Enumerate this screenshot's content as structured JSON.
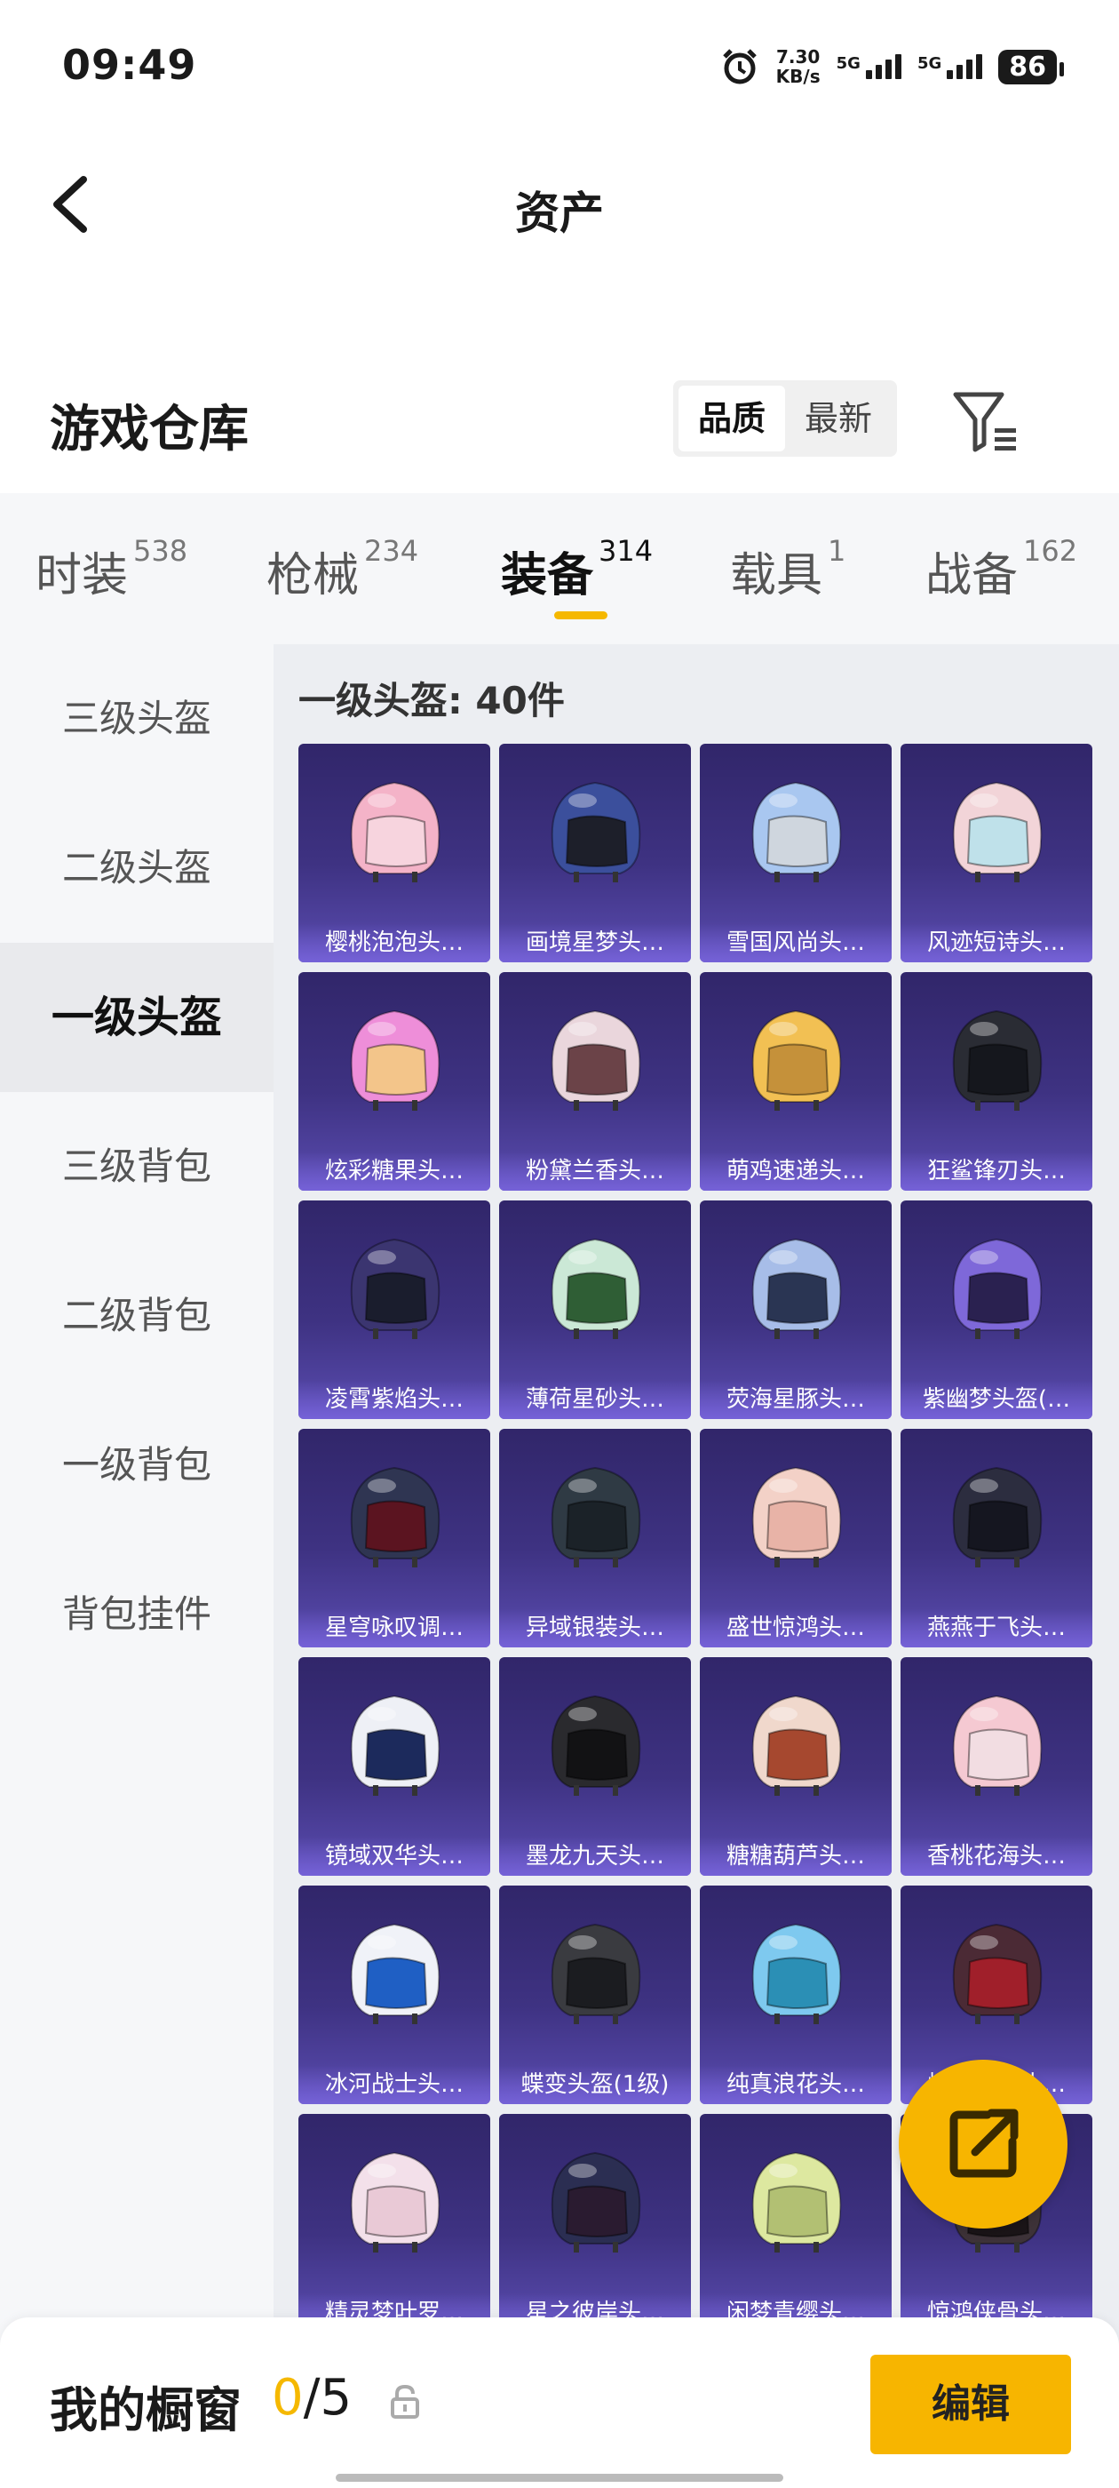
{
  "status_bar": {
    "time": "09:49",
    "net_speed_value": "7.30",
    "net_speed_unit": "KB/s",
    "sim1": "5G",
    "sim2": "5G",
    "battery": "86"
  },
  "nav": {
    "title": "资产",
    "back_icon": "chevron-left-icon"
  },
  "header": {
    "title": "游戏仓库",
    "sort_options": [
      "品质",
      "最新"
    ],
    "sort_selected": "品质",
    "filter_icon": "filter-icon"
  },
  "tabs": [
    {
      "label": "时装",
      "count": "538"
    },
    {
      "label": "枪械",
      "count": "234"
    },
    {
      "label": "装备",
      "count": "314"
    },
    {
      "label": "载具",
      "count": "1"
    },
    {
      "label": "战备",
      "count": "162"
    }
  ],
  "active_tab": "装备",
  "sidebar": {
    "items": [
      "三级头盔",
      "二级头盔",
      "一级头盔",
      "三级背包",
      "二级背包",
      "一级背包",
      "背包挂件"
    ],
    "active": "一级头盔"
  },
  "section_title": "一级头盔: 40件",
  "items": [
    {
      "label": "樱桃泡泡头…",
      "color": "#f4b3c8",
      "visor": "#f7d4de"
    },
    {
      "label": "画境星梦头…",
      "color": "#3b4f9c",
      "visor": "#1d1f2a"
    },
    {
      "label": "雪国风尚头…",
      "color": "#a9c7f0",
      "visor": "#cfd6de"
    },
    {
      "label": "风迹短诗头…",
      "color": "#f2d4d8",
      "visor": "#bfe1ea"
    },
    {
      "label": "炫彩糖果头…",
      "color": "#ee8ed9",
      "visor": "#f3c58a"
    },
    {
      "label": "粉黛兰香头…",
      "color": "#ead6dc",
      "visor": "#6b4348"
    },
    {
      "label": "萌鸡速递头…",
      "color": "#f2c053",
      "visor": "#c5913a"
    },
    {
      "label": "狂鲨锋刃头…",
      "color": "#2a2c34",
      "visor": "#15171d"
    },
    {
      "label": "凌霄紫焰头…",
      "color": "#3b3570",
      "visor": "#1a1d2d"
    },
    {
      "label": "薄荷星砂头…",
      "color": "#cbe8d6",
      "visor": "#2f5e35"
    },
    {
      "label": "荧海星豚头…",
      "color": "#a7bde8",
      "visor": "#2a3553"
    },
    {
      "label": "紫幽梦头盔(…",
      "color": "#7e68d9",
      "visor": "#2a2150"
    },
    {
      "label": "星穹咏叹调…",
      "color": "#2f3552",
      "visor": "#5b1420"
    },
    {
      "label": "异域银装头…",
      "color": "#2f3a44",
      "visor": "#1b2228"
    },
    {
      "label": "盛世惊鸿头…",
      "color": "#f3d1c7",
      "visor": "#e8b3a7"
    },
    {
      "label": "燕燕于飞头…",
      "color": "#2c2d3f",
      "visor": "#151620"
    },
    {
      "label": "镜域双华头…",
      "color": "#eef0f6",
      "visor": "#1c2a5c"
    },
    {
      "label": "墨龙九天头…",
      "color": "#2a2a2e",
      "visor": "#121214"
    },
    {
      "label": "糖糖葫芦头…",
      "color": "#f0d8cc",
      "visor": "#a6482f"
    },
    {
      "label": "香桃花海头…",
      "color": "#f5c9d2",
      "visor": "#f2dde2"
    },
    {
      "label": "冰河战士头…",
      "color": "#f0f2f8",
      "visor": "#1f5fc4"
    },
    {
      "label": "蝶变头盔(1级)",
      "color": "#3a3b40",
      "visor": "#1b1c20"
    },
    {
      "label": "纯真浪花头…",
      "color": "#7ec9ef",
      "visor": "#2b8fb5"
    },
    {
      "label": "烁金漫步头…",
      "color": "#4b2a35",
      "visor": "#a01f2a"
    },
    {
      "label": "精灵梦叶罗…",
      "color": "#f3e0ea",
      "visor": "#e9c9d6"
    },
    {
      "label": "星之彼岸头…",
      "color": "#2b2e52",
      "visor": "#2a1b30"
    },
    {
      "label": "闲梦青缨头…",
      "color": "#dde8a0",
      "visor": "#b2c073"
    },
    {
      "label": "惊鸿侠骨头…",
      "color": "#3d3238",
      "visor": "#1b1518"
    }
  ],
  "fab_icon": "share-external-icon",
  "bottom": {
    "label": "我的橱窗",
    "current": "0",
    "separator": "/5",
    "lock_icon": "lock-icon",
    "edit_label": "编辑"
  }
}
